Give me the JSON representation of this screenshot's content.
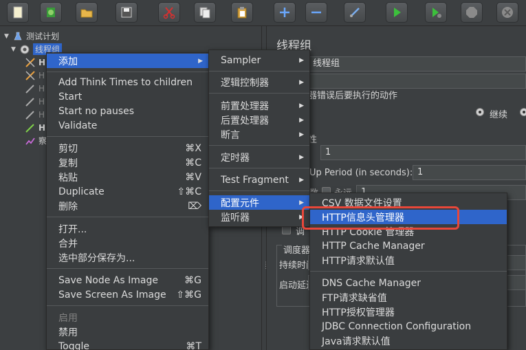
{
  "toolbar": {
    "buttons": [
      "new-icon",
      "templates-icon",
      "open-icon",
      "save-icon",
      "cut-icon",
      "copy-icon",
      "paste-icon",
      "expand-icon",
      "collapse-icon",
      "toggle-icon",
      "start-icon",
      "start-no-pause-icon",
      "stop-icon",
      "shutdown-icon"
    ]
  },
  "tree": {
    "root_label": "测试计划",
    "thread_group_label": "线程组",
    "children_letters": [
      "H",
      "H",
      "H",
      "H",
      "H",
      "H",
      "察"
    ]
  },
  "right_panel": {
    "title": "线程组",
    "name_value": "线程组",
    "error_action_label": "器错误后要执行的动作",
    "continue_label": "继续",
    "section_label": "性",
    "threads_value": "1",
    "rampup_label": "Up Period (in seconds):",
    "rampup_value": "1",
    "loop_prefix": "数",
    "loop_forever": "永远",
    "loop_value": "1",
    "delay_label": "调",
    "scheduler_label": "调度器",
    "duration_label": "持续时间",
    "startup_delay_label": "启动延迟"
  },
  "context_menu": {
    "add": "添加",
    "add_think_times": "Add Think Times to children",
    "start": "Start",
    "start_no_pauses": "Start no pauses",
    "validate": "Validate",
    "cut": "剪切",
    "cut_sc": "⌘X",
    "copy": "复制",
    "copy_sc": "⌘C",
    "paste": "粘贴",
    "paste_sc": "⌘V",
    "duplicate": "Duplicate",
    "duplicate_sc": "⇧⌘C",
    "delete": "删除",
    "delete_sc": "⌦",
    "open": "打开...",
    "merge": "合并",
    "save_selection": "选中部分保存为...",
    "save_node_image": "Save Node As Image",
    "save_node_image_sc": "⌘G",
    "save_screen_image": "Save Screen As Image",
    "save_screen_image_sc": "⇧⌘G",
    "enable": "启用",
    "disable": "禁用",
    "toggle": "Toggle",
    "toggle_sc": "⌘T"
  },
  "add_submenu": {
    "sampler": "Sampler",
    "logic_controller": "逻辑控制器",
    "pre_processors": "前置处理器",
    "post_processors": "后置处理器",
    "assertions": "断言",
    "timer": "定时器",
    "test_fragment": "Test Fragment",
    "config_element": "配置元件",
    "listener": "监听器"
  },
  "config_submenu": {
    "items": [
      "CSV 数据文件设置",
      "HTTP信息头管理器",
      "HTTP Cookie 管理器",
      "HTTP Cache Manager",
      "HTTP请求默认值",
      "DNS Cache Manager",
      "FTP请求缺省值",
      "HTTP授权管理器",
      "JDBC Connection Configuration",
      "Java请求默认值"
    ]
  },
  "colors": {
    "highlight": "#2f65ca",
    "annotation": "#e8473a",
    "background": "#3c3f41"
  }
}
